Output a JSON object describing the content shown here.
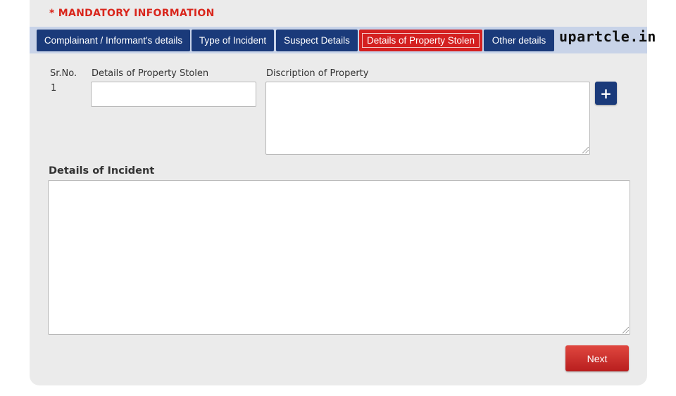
{
  "header": {
    "mandatory_text": "* MANDATORY INFORMATION",
    "watermark": "upartcle.in"
  },
  "tabs": [
    {
      "label": "Complainant / Informant's details",
      "active": false
    },
    {
      "label": "Type of Incident",
      "active": false
    },
    {
      "label": "Suspect Details",
      "active": false
    },
    {
      "label": "Details of Property Stolen",
      "active": true
    },
    {
      "label": "Other details",
      "active": false
    }
  ],
  "property_form": {
    "srno_label": "Sr.No.",
    "row_number": "1",
    "property_label": "Details of Property Stolen",
    "property_value": "",
    "description_label": "Discription of Property",
    "description_value": "",
    "add_button": "+"
  },
  "incident": {
    "title": "Details of Incident",
    "value": ""
  },
  "actions": {
    "next_label": "Next"
  },
  "colors": {
    "tab_bg": "#1a3a7a",
    "tab_active_bg": "#d42020",
    "mandatory_red": "#d9261c",
    "next_red": "#c8302c"
  }
}
